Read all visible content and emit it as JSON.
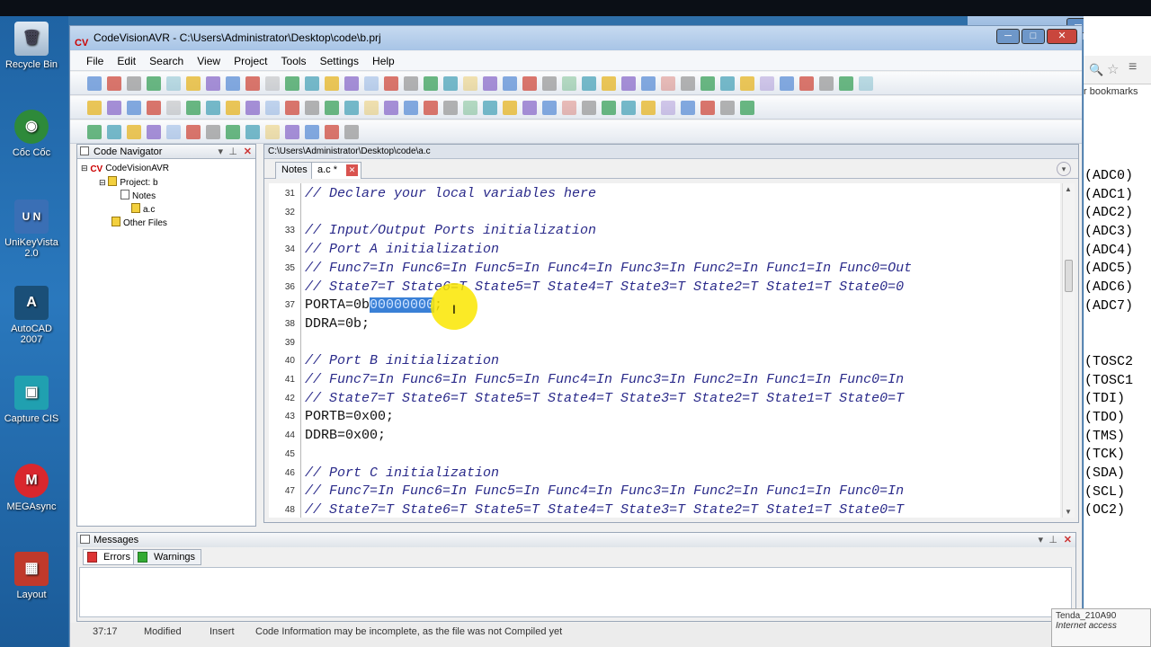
{
  "desktop_icons": [
    {
      "label": "Recycle Bin",
      "icon": "recycle-bin-icon"
    },
    {
      "label": "Cốc Cốc",
      "icon": "coccoc-icon"
    },
    {
      "label": "UniKeyVista 2.0",
      "icon": "unikey-icon"
    },
    {
      "label": "AutoCAD 2007",
      "icon": "autocad-icon"
    },
    {
      "label": "Capture CIS",
      "icon": "capture-cis-icon"
    },
    {
      "label": "MEGAsync",
      "icon": "megasync-icon"
    },
    {
      "label": "Layout",
      "icon": "layout-icon"
    }
  ],
  "window": {
    "title": "CodeVisionAVR - C:\\Users\\Administrator\\Desktop\\code\\b.prj",
    "logo": "CV"
  },
  "menu": [
    "File",
    "Edit",
    "Search",
    "View",
    "Project",
    "Tools",
    "Settings",
    "Help"
  ],
  "navigator": {
    "title": "Code Navigator",
    "root": "CodeVisionAVR",
    "project": "Project: b",
    "notes": "Notes",
    "file": "a.c",
    "other": "Other Files"
  },
  "editor": {
    "path": "C:\\Users\\Administrator\\Desktop\\code\\a.c",
    "tabs": [
      "Notes",
      "a.c *"
    ],
    "lines": [
      {
        "n": "31",
        "text": "// Declare your local variables here",
        "comment": true
      },
      {
        "n": "32",
        "text": "",
        "comment": false
      },
      {
        "n": "33",
        "text": "// Input/Output Ports initialization",
        "comment": true
      },
      {
        "n": "34",
        "text": "// Port A initialization",
        "comment": true
      },
      {
        "n": "35",
        "text": "// Func7=In Func6=In Func5=In Func4=In Func3=In Func2=In Func1=In Func0=Out",
        "comment": true
      },
      {
        "n": "36",
        "text": "// State7=T State6=T State5=T State4=T State3=T State2=T State1=T State0=0",
        "comment": true
      },
      {
        "n": "37",
        "text": "PORTA=0b",
        "comment": false
      },
      {
        "n": "38",
        "text": "DDRA=0b;",
        "comment": false
      },
      {
        "n": "39",
        "text": "",
        "comment": false
      },
      {
        "n": "40",
        "text": "// Port B initialization",
        "comment": true
      },
      {
        "n": "41",
        "text": "// Func7=In Func6=In Func5=In Func4=In Func3=In Func2=In Func1=In Func0=In",
        "comment": true
      },
      {
        "n": "42",
        "text": "// State7=T State6=T State5=T State4=T State3=T State2=T State1=T State0=T",
        "comment": true
      },
      {
        "n": "43",
        "text": "PORTB=0x00;",
        "comment": false
      },
      {
        "n": "44",
        "text": "DDRB=0x00;",
        "comment": false
      },
      {
        "n": "45",
        "text": "",
        "comment": false
      },
      {
        "n": "46",
        "text": "// Port C initialization",
        "comment": true
      },
      {
        "n": "47",
        "text": "// Func7=In Func6=In Func5=In Func4=In Func3=In Func2=In Func1=In Func0=In",
        "comment": true
      },
      {
        "n": "48",
        "text": "// State7=T State6=T State5=T State4=T State3=T State2=T State1=T State0=T",
        "comment": true
      }
    ],
    "selected_text": "00000000",
    "after_selection": ";"
  },
  "messages": {
    "title": "Messages",
    "tab_errors": "Errors",
    "tab_warnings": "Warnings"
  },
  "status": {
    "pos": "37:17",
    "modified": "Modified",
    "mode": "Insert",
    "info": "Code Information may be incomplete, as the file was not Compiled yet"
  },
  "browser_partial": {
    "bookmarks": "r bookmarks",
    "pins": [
      "(ADC0)",
      "(ADC1)",
      "(ADC2)",
      "(ADC3)",
      "(ADC4)",
      "(ADC5)",
      "(ADC6)",
      "(ADC7)",
      "",
      "",
      "(TOSC2",
      "(TOSC1",
      "(TDI)",
      "(TDO)",
      "(TMS)",
      "(TCK)",
      "(SDA)",
      "(SCL)",
      "(OC2)"
    ]
  },
  "tooltip": {
    "line1": "Tenda_210A90",
    "line2": "Internet access"
  }
}
